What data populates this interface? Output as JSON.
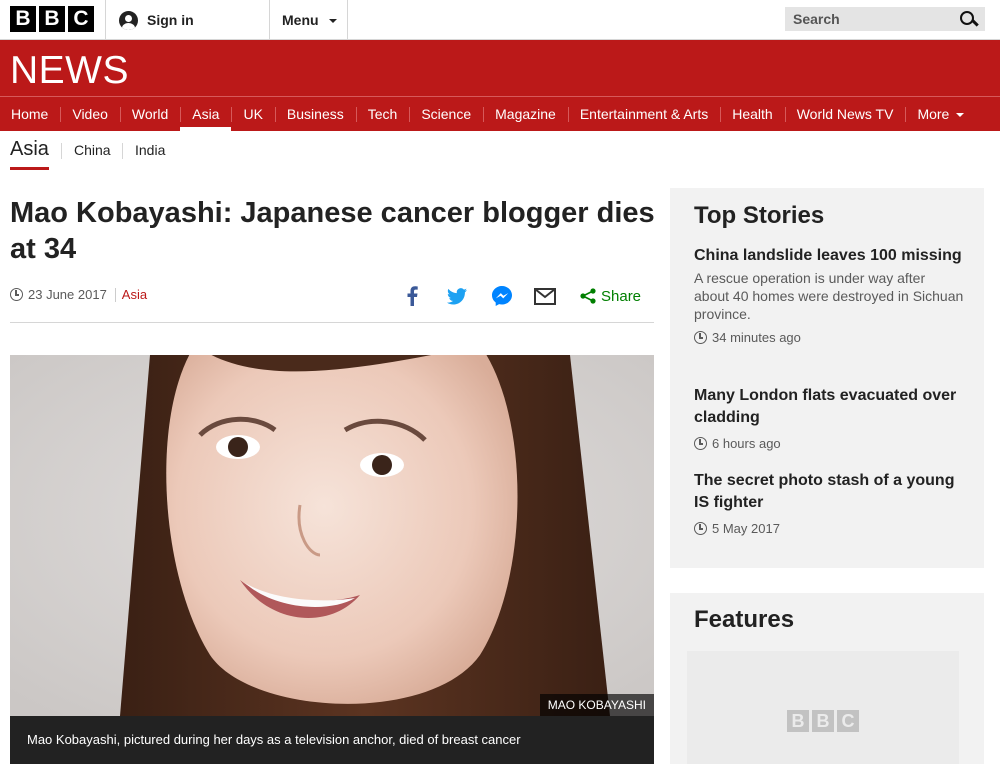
{
  "header": {
    "logo_letters": [
      "B",
      "B",
      "C"
    ],
    "signin_label": "Sign in",
    "menu_label": "Menu",
    "search_placeholder": "Search"
  },
  "banner": {
    "title": "NEWS",
    "color": "#bb1919"
  },
  "nav": {
    "items": [
      {
        "label": "Home"
      },
      {
        "label": "Video"
      },
      {
        "label": "World"
      },
      {
        "label": "Asia",
        "active": true
      },
      {
        "label": "UK"
      },
      {
        "label": "Business"
      },
      {
        "label": "Tech"
      },
      {
        "label": "Science"
      },
      {
        "label": "Magazine"
      },
      {
        "label": "Entertainment & Arts"
      },
      {
        "label": "Health"
      },
      {
        "label": "World News TV"
      },
      {
        "label": "More"
      }
    ]
  },
  "subnav": {
    "title": "Asia",
    "items": [
      {
        "label": "China"
      },
      {
        "label": "India"
      }
    ]
  },
  "article": {
    "headline": "Mao Kobayashi: Japanese cancer blogger dies at 34",
    "date": "23 June 2017",
    "section": "Asia",
    "share_label": "Share",
    "share_icons": [
      "facebook-icon",
      "twitter-icon",
      "messenger-icon",
      "email-icon",
      "share-icon"
    ],
    "image_credit": "MAO KOBAYASHI",
    "caption": "Mao Kobayashi, pictured during her days as a television anchor, died of breast cancer"
  },
  "sidebar": {
    "top_stories_heading": "Top Stories",
    "stories": [
      {
        "title": "China landslide leaves 100 missing",
        "summary": "A rescue operation is under way after about 40 homes were destroyed in Sichuan province.",
        "time": "34 minutes ago"
      },
      {
        "title": "Many London flats evacuated over cladding",
        "time": "6 hours ago"
      },
      {
        "title": "The secret photo stash of a young IS fighter",
        "time": "5 May 2017"
      }
    ],
    "features_heading": "Features",
    "features_logo_letters": [
      "B",
      "B",
      "C"
    ]
  }
}
